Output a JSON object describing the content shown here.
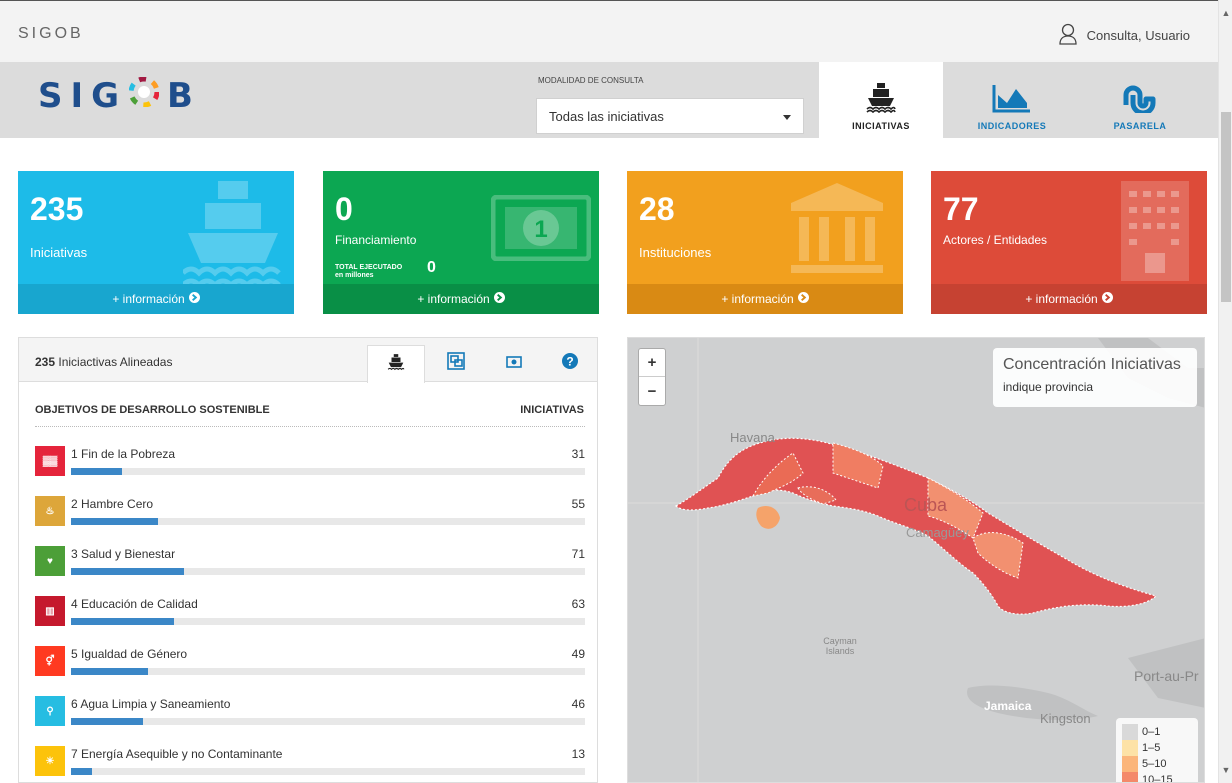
{
  "topbar": {
    "brand": "SIGOB",
    "user": "Consulta, Usuario"
  },
  "header": {
    "logo_left": "SIG",
    "logo_right": "B",
    "modality_label": "MODALIDAD DE CONSULTA",
    "modality_value": "Todas las iniciativas",
    "tabs": [
      {
        "label": "INICIATIVAS",
        "icon": "ship-icon",
        "active": true
      },
      {
        "label": "INDICADORES",
        "icon": "area-chart-icon",
        "active": false
      },
      {
        "label": "PASARELA",
        "icon": "stumbleupon-icon",
        "active": false
      }
    ]
  },
  "cards": [
    {
      "value": "235",
      "label": "Iniciativas",
      "more": "+ información",
      "color": "#1dbbe8",
      "icon": "ship-icon"
    },
    {
      "value": "0",
      "label": "Financiamiento",
      "sub_label_1": "TOTAL EJECUTADO",
      "sub_label_2": "en millones",
      "sub_value": "0",
      "more": "+ información",
      "color": "#0ca752",
      "icon": "money-icon"
    },
    {
      "value": "28",
      "label": "Instituciones",
      "more": "+ información",
      "color": "#f2a01e",
      "icon": "institution-icon"
    },
    {
      "value": "77",
      "label": "Actores / Entidades",
      "more": "+ información",
      "color": "#dd4b39",
      "icon": "building-icon"
    }
  ],
  "panel": {
    "count": "235",
    "title": "Iniciactivas Alineadas",
    "col_left": "OBJETIVOS DE DESARROLLO SOSTENIBLE",
    "col_right": "INICIATIVAS",
    "max_value": 71,
    "rows": [
      {
        "name": "1 Fin de la Pobreza",
        "value": 31,
        "color": "#e5243b",
        "icon": "people-icon"
      },
      {
        "name": "2 Hambre Cero",
        "value": 55,
        "color": "#dda63a",
        "icon": "bowl-icon"
      },
      {
        "name": "3 Salud y Bienestar",
        "value": 71,
        "color": "#4c9f38",
        "icon": "heartbeat-icon"
      },
      {
        "name": "4 Educación de Calidad",
        "value": 63,
        "color": "#c5192d",
        "icon": "book-icon"
      },
      {
        "name": "5 Igualdad de Género",
        "value": 49,
        "color": "#ff3a21",
        "icon": "gender-icon"
      },
      {
        "name": "6 Agua Limpia y Saneamiento",
        "value": 46,
        "color": "#26bde2",
        "icon": "water-icon"
      },
      {
        "name": "7 Energía Asequible y no Contaminante",
        "value": 13,
        "color": "#fcc30b",
        "icon": "sun-icon"
      }
    ]
  },
  "map": {
    "title": "Concentración Iniciativas",
    "subtitle": "indique provincia",
    "zoom_in": "+",
    "zoom_out": "−",
    "places": {
      "havana": "Havana",
      "cuba": "Cuba",
      "camaguey": "Camagüey",
      "cayman": "Cayman Islands",
      "jamaica": "Jamaica",
      "kingston": "Kingston",
      "port": "Port-au-Pr"
    },
    "legend": [
      {
        "label": "0–1",
        "color": "#d9d9d9"
      },
      {
        "label": "1–5",
        "color": "#fde2a6"
      },
      {
        "label": "5–10",
        "color": "#fbb57a"
      },
      {
        "label": "10–15",
        "color": "#f4896a"
      }
    ]
  }
}
